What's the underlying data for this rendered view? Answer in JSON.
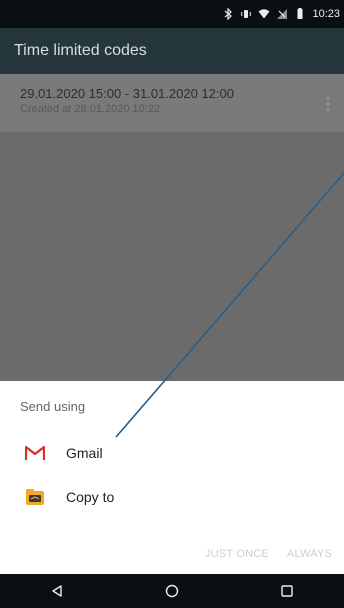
{
  "status": {
    "time": "10:23",
    "icons": [
      "bluetooth-icon",
      "vibrate-icon",
      "wifi-icon",
      "no-signal-icon",
      "battery-icon"
    ]
  },
  "appbar": {
    "title": "Time limited codes"
  },
  "list": {
    "items": [
      {
        "title": "29.01.2020 15:00 - 31.01.2020 12:00",
        "subtitle": "Created at 28.01.2020 10:22"
      }
    ]
  },
  "sheet": {
    "header": "Send using",
    "options": [
      {
        "label": "Gmail",
        "icon": "gmail-icon"
      },
      {
        "label": "Copy to",
        "icon": "copy-to-icon"
      }
    ],
    "just_once": "JUST ONCE",
    "always": "ALWAYS"
  },
  "nav": {
    "icons": [
      "back-icon",
      "home-icon",
      "recents-icon"
    ]
  },
  "colors": {
    "appbar": "#25373c",
    "scrim": "#6b6b6b",
    "annotation_line": "#2b5f87",
    "gmail_red": "#d93025"
  }
}
